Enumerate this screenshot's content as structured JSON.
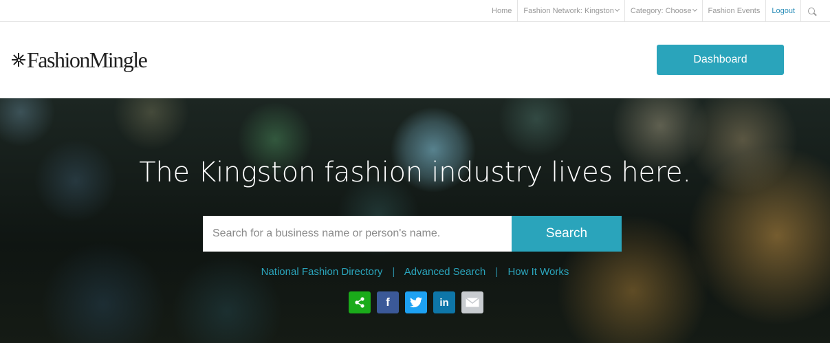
{
  "topbar": {
    "home": "Home",
    "network": "Fashion Network: Kingston",
    "category": "Category: Choose",
    "events": "Fashion Events",
    "logout": "Logout"
  },
  "header": {
    "logo_text": "FashionMingle",
    "dashboard_label": "Dashboard"
  },
  "hero": {
    "title": "The Kingston fashion industry lives here.",
    "search_placeholder": "Search for a business name or person's name.",
    "search_label": "Search",
    "links": {
      "directory": "National Fashion Directory",
      "advanced": "Advanced Search",
      "how": "How It Works",
      "separator": "|"
    },
    "social": {
      "facebook_glyph": "f",
      "linkedin_glyph": "in"
    }
  },
  "icons": {
    "topbar_search": "search-icon",
    "share": "share-icon",
    "facebook": "facebook-icon",
    "twitter": "twitter-icon",
    "linkedin": "linkedin-icon",
    "email": "email-icon"
  },
  "colors": {
    "accent": "#2aa4bb",
    "logout": "#2a8db8",
    "share": "#1aab1a",
    "facebook": "#3b5998",
    "twitter": "#1da1f2",
    "linkedin": "#0e76a8",
    "email": "#c8ccd0"
  }
}
